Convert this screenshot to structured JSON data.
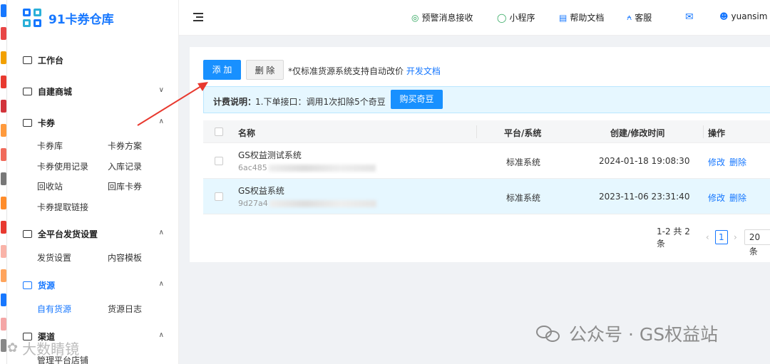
{
  "app": {
    "title": "91卡券仓库"
  },
  "sidebar": {
    "groups": [
      {
        "label": "工作台"
      },
      {
        "label": "自建商城"
      },
      {
        "label": "卡券"
      },
      {
        "label": "全平台发货设置"
      },
      {
        "label": "货源"
      },
      {
        "label": "渠道"
      }
    ],
    "card_items": [
      "卡券库",
      "卡券方案",
      "卡券使用记录",
      "入库记录",
      "回收站",
      "回库卡券",
      "卡券提取链接"
    ],
    "delivery_items": [
      "发货设置",
      "内容模板"
    ],
    "source_items": [
      "自有货源",
      "货源日志"
    ],
    "channel_items": [
      "管理平台店铺"
    ]
  },
  "header": {
    "alert": "预警消息接收",
    "miniapp": "小程序",
    "help": "帮助文档",
    "service": "客服",
    "user": "yuansim"
  },
  "toolbar": {
    "add_label": "添 加",
    "delete_label": "删 除",
    "note": "*仅标准货源系统支持自动改价",
    "dev_doc": "开发文档"
  },
  "billing": {
    "title": "计费说明：",
    "text": "1.下单接口：调用1次扣除5个奇豆",
    "buy_label": "购买奇豆"
  },
  "table": {
    "headers": {
      "name": "名称",
      "platform": "平台/系统",
      "time": "创建/修改时间",
      "ops": "操作"
    },
    "rows": [
      {
        "name": "GS权益测试系统",
        "id": "6ac485",
        "platform": "标准系统",
        "time": "2024-01-18 19:08:30",
        "edit": "修改",
        "delete": "删除"
      },
      {
        "name": "GS权益系统",
        "id": "9d27a4",
        "platform": "标准系统",
        "time": "2023-11-06 23:31:40",
        "edit": "修改",
        "delete": "删除"
      }
    ]
  },
  "pagination": {
    "summary": "1-2 共 2 条",
    "current": "1",
    "page_size": "20 条"
  },
  "watermark": {
    "text": "公众号 · GS权益站",
    "secondary": "大数睛镜"
  },
  "colors": {
    "accent": "#1890ff",
    "info_bg": "#e6f7ff",
    "arrow": "#e8392f"
  }
}
